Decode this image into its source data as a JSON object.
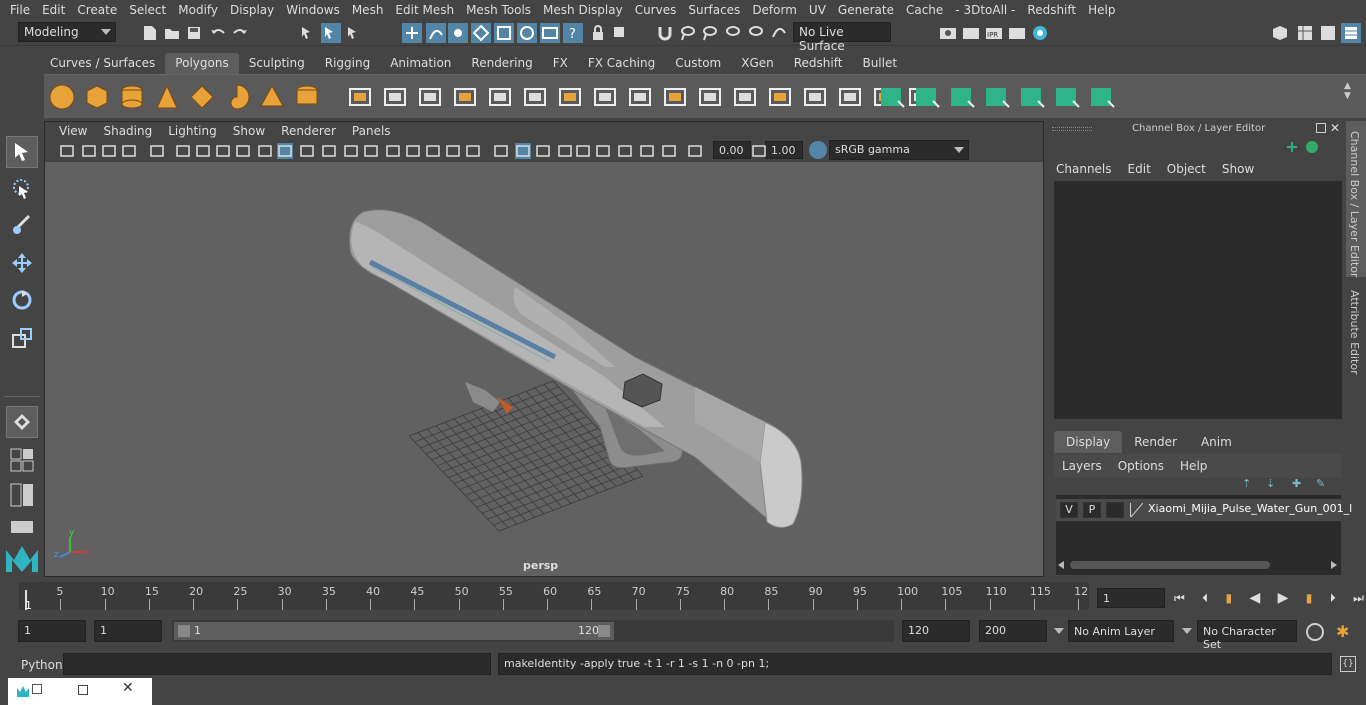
{
  "menubar": [
    "File",
    "Edit",
    "Create",
    "Select",
    "Modify",
    "Display",
    "Windows",
    "Mesh",
    "Edit Mesh",
    "Mesh Tools",
    "Mesh Display",
    "Curves",
    "Surfaces",
    "Deform",
    "UV",
    "Generate",
    "Cache",
    "- 3DtoAll -",
    "Redshift",
    "Help"
  ],
  "status": {
    "mode": "Modeling",
    "live_surface": "No Live Surface"
  },
  "shelf_tabs": [
    "Curves / Surfaces",
    "Polygons",
    "Sculpting",
    "Rigging",
    "Animation",
    "Rendering",
    "FX",
    "FX Caching",
    "Custom",
    "XGen",
    "Redshift",
    "Bullet"
  ],
  "shelf_active": "Polygons",
  "viewport": {
    "menu": [
      "View",
      "Shading",
      "Lighting",
      "Show",
      "Renderer",
      "Panels"
    ],
    "exposure": "0.00",
    "gamma": "1.00",
    "color_space": "sRGB gamma",
    "camera_label": "persp",
    "axis_x": "x",
    "axis_y": "y",
    "axis_z": "z"
  },
  "channel_box": {
    "title": "Channel Box / Layer Editor",
    "menu": [
      "Channels",
      "Edit",
      "Object",
      "Show"
    ],
    "side_tab_1": "Channel Box / Layer Editor",
    "side_tab_2": "Attribute Editor"
  },
  "layer_editor": {
    "tabs": [
      "Display",
      "Render",
      "Anim"
    ],
    "active_tab": "Display",
    "menu": [
      "Layers",
      "Options",
      "Help"
    ],
    "layer": {
      "v": "V",
      "p": "P",
      "name": "Xiaomi_Mijia_Pulse_Water_Gun_001_l"
    }
  },
  "timeline": {
    "ticks": [
      "5",
      "10",
      "15",
      "20",
      "25",
      "30",
      "35",
      "40",
      "45",
      "50",
      "55",
      "60",
      "65",
      "70",
      "75",
      "80",
      "85",
      "90",
      "95",
      "100",
      "105",
      "110",
      "115",
      "12"
    ],
    "start_marker": "1",
    "current_frame": "1"
  },
  "range": {
    "start": "1",
    "current": "1",
    "slider_start": "1",
    "slider_end": "120",
    "end": "120",
    "anim_end": "200",
    "anim_layer": "No Anim Layer",
    "character_set": "No Character Set"
  },
  "command": {
    "lang": "Python",
    "input": "",
    "result": "makeIdentity -apply true -t 1 -r 1 -s 1 -n 0 -pn 1;"
  },
  "colors": {
    "accent": "#5285a6",
    "shelf_icon": "#e8a23a",
    "shelf_green": "#2fb48a"
  }
}
